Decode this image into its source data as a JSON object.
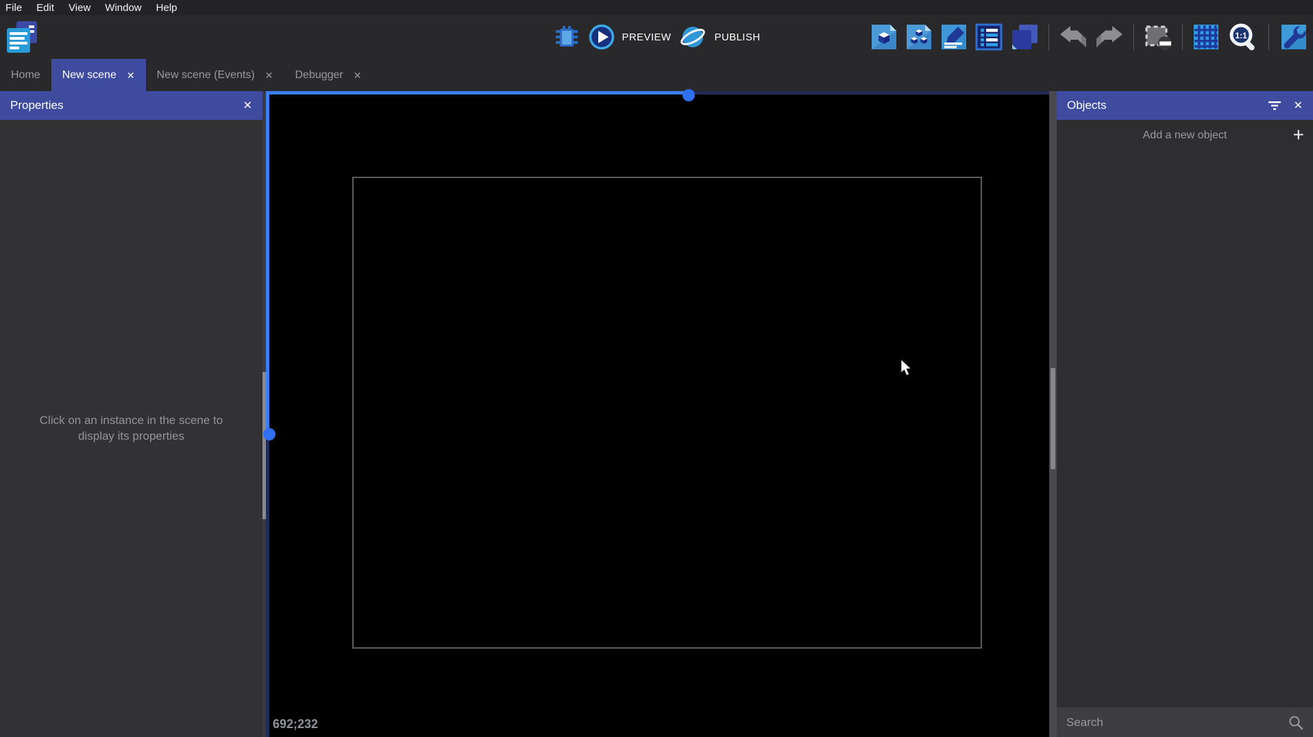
{
  "menu": {
    "items": [
      "File",
      "Edit",
      "View",
      "Window",
      "Help"
    ]
  },
  "toolbar": {
    "preview_label": "PREVIEW",
    "publish_label": "PUBLISH",
    "zoom_ratio_label": "1:1",
    "right_icons": [
      "open-editors-page",
      "object-groups",
      "scene-properties-edit",
      "instances-list",
      "layers",
      "undo",
      "redo",
      "edit-selection-mask",
      "grid",
      "zoom-original",
      "scene-settings"
    ]
  },
  "tabs": {
    "close_glyph": "✕",
    "items": [
      {
        "label": "Home",
        "active": false,
        "closable": false
      },
      {
        "label": "New scene",
        "active": true,
        "closable": true
      },
      {
        "label": "New scene (Events)",
        "active": false,
        "closable": true
      },
      {
        "label": "Debugger",
        "active": false,
        "closable": true
      }
    ]
  },
  "properties_panel": {
    "title": "Properties",
    "close_glyph": "✕",
    "hint_line1": "Click on an instance in the scene to",
    "hint_line2": "display its properties"
  },
  "scene": {
    "cursor_coordinates": "692;232"
  },
  "objects_panel": {
    "title": "Objects",
    "close_glyph": "✕",
    "add_object_label": "Add a new object",
    "add_glyph": "+",
    "search_placeholder": "Search"
  },
  "colors": {
    "accent_blue": "#3d7ef5",
    "header_indigo": "#3e4b9e",
    "selection_navy": "#202c55",
    "canvas_black": "#000000"
  }
}
